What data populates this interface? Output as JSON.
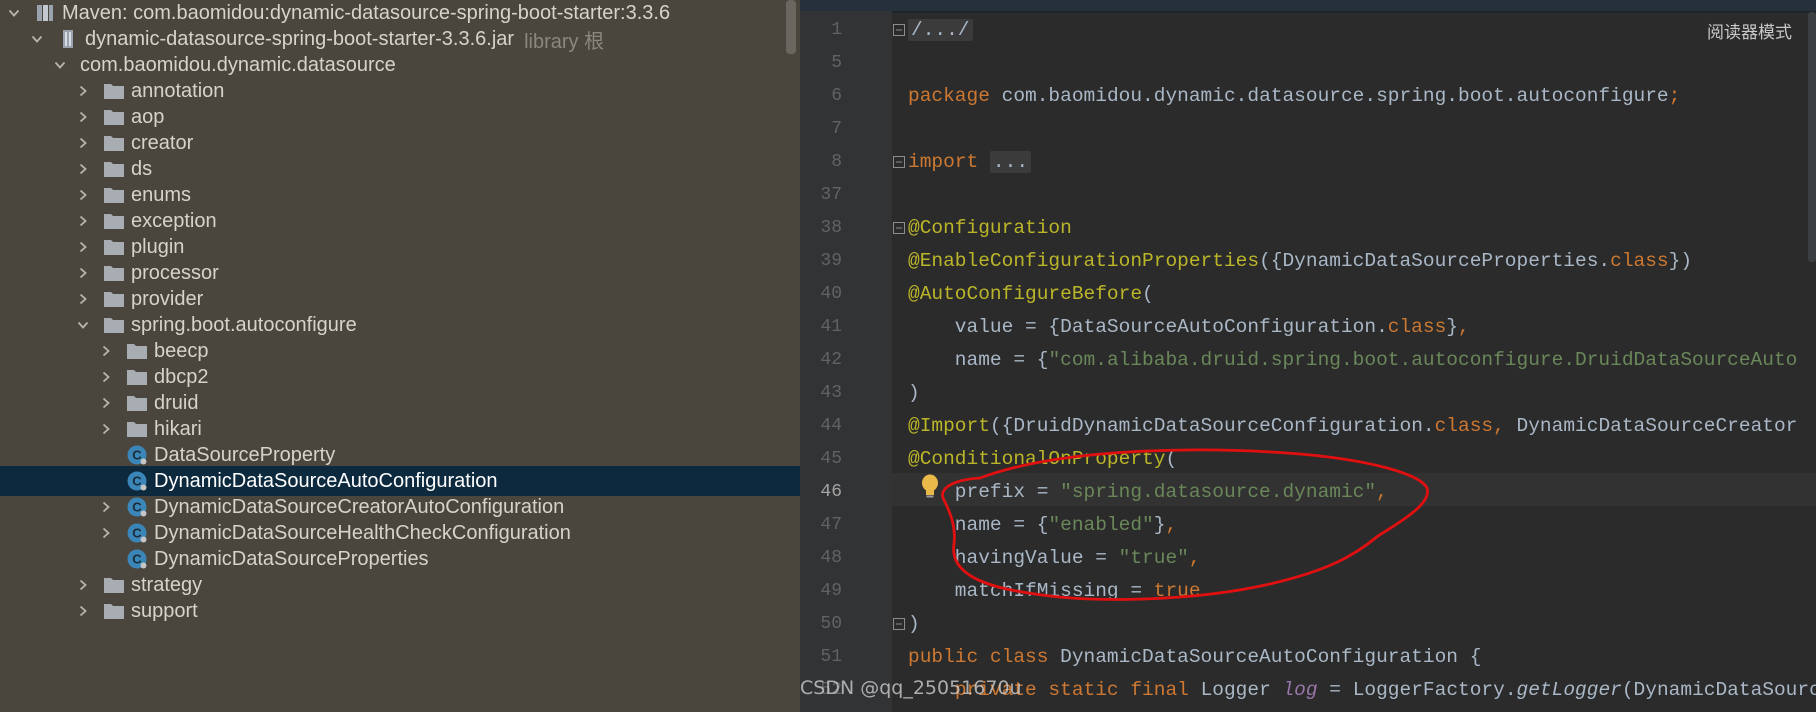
{
  "tree": {
    "rows": [
      {
        "label": "Maven: com.baomidou:dynamic-datasource-spring-boot-starter:3.3.6",
        "arrow": "down",
        "icon": "library-icon",
        "indent": 0
      },
      {
        "label": "dynamic-datasource-spring-boot-starter-3.3.6.jar",
        "hint": "library 根",
        "arrow": "down",
        "icon": "jar-icon",
        "indent": 1
      },
      {
        "label": "com.baomidou.dynamic.datasource",
        "arrow": "down",
        "icon": "none",
        "indent": 2
      },
      {
        "label": "annotation",
        "arrow": "right",
        "icon": "folder-icon",
        "indent": 3
      },
      {
        "label": "aop",
        "arrow": "right",
        "icon": "folder-icon",
        "indent": 3
      },
      {
        "label": "creator",
        "arrow": "right",
        "icon": "folder-icon",
        "indent": 3
      },
      {
        "label": "ds",
        "arrow": "right",
        "icon": "folder-icon",
        "indent": 3
      },
      {
        "label": "enums",
        "arrow": "right",
        "icon": "folder-icon",
        "indent": 3
      },
      {
        "label": "exception",
        "arrow": "right",
        "icon": "folder-icon",
        "indent": 3
      },
      {
        "label": "plugin",
        "arrow": "right",
        "icon": "folder-icon",
        "indent": 3
      },
      {
        "label": "processor",
        "arrow": "right",
        "icon": "folder-icon",
        "indent": 3
      },
      {
        "label": "provider",
        "arrow": "right",
        "icon": "folder-icon",
        "indent": 3
      },
      {
        "label": "spring.boot.autoconfigure",
        "arrow": "down",
        "icon": "folder-icon",
        "indent": 3
      },
      {
        "label": "beecp",
        "arrow": "right",
        "icon": "folder-icon",
        "indent": 4
      },
      {
        "label": "dbcp2",
        "arrow": "right",
        "icon": "folder-icon",
        "indent": 4
      },
      {
        "label": "druid",
        "arrow": "right",
        "icon": "folder-icon",
        "indent": 4
      },
      {
        "label": "hikari",
        "arrow": "right",
        "icon": "folder-icon",
        "indent": 4
      },
      {
        "label": "DataSourceProperty",
        "arrow": "none",
        "icon": "class-icon",
        "indent": 4
      },
      {
        "label": "DynamicDataSourceAutoConfiguration",
        "arrow": "none",
        "icon": "class-icon",
        "indent": 4,
        "selected": true
      },
      {
        "label": "DynamicDataSourceCreatorAutoConfiguration",
        "arrow": "right",
        "icon": "class-icon",
        "indent": 4
      },
      {
        "label": "DynamicDataSourceHealthCheckConfiguration",
        "arrow": "right",
        "icon": "class-icon",
        "indent": 4
      },
      {
        "label": "DynamicDataSourceProperties",
        "arrow": "none",
        "icon": "class-icon",
        "indent": 4
      },
      {
        "label": "strategy",
        "arrow": "right",
        "icon": "folder-icon",
        "indent": 3
      },
      {
        "label": "support",
        "arrow": "right",
        "icon": "folder-icon",
        "indent": 3
      }
    ]
  },
  "editor": {
    "reader_mode": "阅读器模式",
    "current_line": "46",
    "watermark": "CSDN @qq_25051670u",
    "lines": [
      {
        "num": "1",
        "fold": true,
        "tokens": [
          {
            "t": "/.../",
            "c": "folded"
          }
        ]
      },
      {
        "num": "5",
        "tokens": []
      },
      {
        "num": "6",
        "tokens": [
          {
            "t": "package ",
            "c": "kw"
          },
          {
            "t": "com.baomidou.dynamic.datasource.spring.boot.autoconfigure"
          },
          {
            "t": ";",
            "c": "kw"
          }
        ]
      },
      {
        "num": "7",
        "tokens": []
      },
      {
        "num": "8",
        "fold": true,
        "tokens": [
          {
            "t": "import ",
            "c": "kw"
          },
          {
            "t": "...",
            "c": "folded"
          }
        ]
      },
      {
        "num": "37",
        "tokens": []
      },
      {
        "num": "38",
        "fold": true,
        "tokens": [
          {
            "t": "@Configuration",
            "c": "ann"
          }
        ]
      },
      {
        "num": "39",
        "tokens": [
          {
            "t": "@EnableConfigurationProperties",
            "c": "ann"
          },
          {
            "t": "({DynamicDataSourceProperties."
          },
          {
            "t": "class",
            "c": "kw"
          },
          {
            "t": "})"
          }
        ]
      },
      {
        "num": "40",
        "tokens": [
          {
            "t": "@AutoConfigureBefore",
            "c": "ann"
          },
          {
            "t": "("
          }
        ]
      },
      {
        "num": "41",
        "tokens": [
          {
            "t": "    value = {DataSourceAutoConfiguration."
          },
          {
            "t": "class",
            "c": "kw"
          },
          {
            "t": "}"
          },
          {
            "t": ",",
            "c": "kw"
          }
        ]
      },
      {
        "num": "42",
        "tokens": [
          {
            "t": "    name = {"
          },
          {
            "t": "\"com.alibaba.druid.spring.boot.autoconfigure.DruidDataSourceAuto",
            "c": "str"
          }
        ]
      },
      {
        "num": "43",
        "tokens": [
          {
            "t": ")"
          }
        ]
      },
      {
        "num": "44",
        "tokens": [
          {
            "t": "@Import",
            "c": "ann"
          },
          {
            "t": "({DruidDynamicDataSourceConfiguration."
          },
          {
            "t": "class",
            "c": "kw"
          },
          {
            "t": ", ",
            "c": "kw"
          },
          {
            "t": "DynamicDataSourceCreator"
          }
        ]
      },
      {
        "num": "45",
        "tokens": [
          {
            "t": "@ConditionalOnProperty",
            "c": "ann"
          },
          {
            "t": "("
          }
        ]
      },
      {
        "num": "46",
        "tokens": [
          {
            "t": "    prefix = "
          },
          {
            "t": "\"spring.datasource.dynamic\"",
            "c": "str"
          },
          {
            "t": ",",
            "c": "kw"
          }
        ]
      },
      {
        "num": "47",
        "tokens": [
          {
            "t": "    name = {"
          },
          {
            "t": "\"enabled\"",
            "c": "str"
          },
          {
            "t": "}"
          },
          {
            "t": ",",
            "c": "kw"
          }
        ]
      },
      {
        "num": "48",
        "tokens": [
          {
            "t": "    havingValue = "
          },
          {
            "t": "\"true\"",
            "c": "str"
          },
          {
            "t": ",",
            "c": "kw"
          }
        ]
      },
      {
        "num": "49",
        "tokens": [
          {
            "t": "    matchIfMissing = "
          },
          {
            "t": "true",
            "c": "kw"
          }
        ]
      },
      {
        "num": "50",
        "fold": true,
        "tokens": [
          {
            "t": ")"
          }
        ]
      },
      {
        "num": "51",
        "tokens": [
          {
            "t": "public class ",
            "c": "kw"
          },
          {
            "t": "DynamicDataSourceAutoConfiguration {"
          }
        ]
      },
      {
        "num": "52",
        "tokens": [
          {
            "t": "    "
          },
          {
            "t": "private static final ",
            "c": "kw"
          },
          {
            "t": "Logger "
          },
          {
            "t": "log",
            "c": "logvar"
          },
          {
            "t": " = LoggerFactory."
          },
          {
            "t": "getLogger",
            "c": "ital"
          },
          {
            "t": "(DynamicDataSourceAutoCo"
          }
        ]
      }
    ]
  },
  "colors": {
    "tree_bg": "#4a463e",
    "selected_bg": "#0d293e",
    "editor_bg": "#2b2b2b",
    "keyword": "#cc7832",
    "string": "#6a8759",
    "annotation": "#bbb529",
    "annotation_circle": "#e01010"
  }
}
